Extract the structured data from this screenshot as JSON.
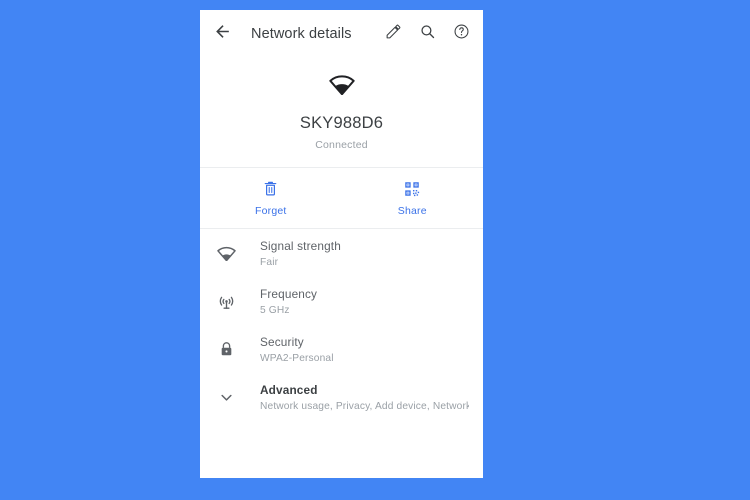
{
  "background_color": "#4285f4",
  "accent_color": "#3b72e8",
  "appbar": {
    "back_icon": "arrow-back-icon",
    "title": "Network details",
    "actions": [
      {
        "icon": "pencil-edit-icon",
        "name": "edit-button"
      },
      {
        "icon": "search-icon",
        "name": "search-button"
      },
      {
        "icon": "help-circle-icon",
        "name": "help-button"
      }
    ]
  },
  "hero": {
    "wifi_icon": "wifi-icon",
    "ssid": "SKY988D6",
    "status": "Connected"
  },
  "actions": [
    {
      "icon": "trash-icon",
      "label": "Forget",
      "name": "forget-button"
    },
    {
      "icon": "qr-code-icon",
      "label": "Share",
      "name": "share-button"
    }
  ],
  "details": [
    {
      "icon": "wifi-icon",
      "title": "Signal strength",
      "value": "Fair"
    },
    {
      "icon": "antenna-icon",
      "title": "Frequency",
      "value": "5 GHz"
    },
    {
      "icon": "lock-icon",
      "title": "Security",
      "value": "WPA2-Personal"
    },
    {
      "icon": "chevron-down-icon",
      "title": "Advanced",
      "value": "Network usage, Privacy, Add device, Network detai.."
    }
  ]
}
